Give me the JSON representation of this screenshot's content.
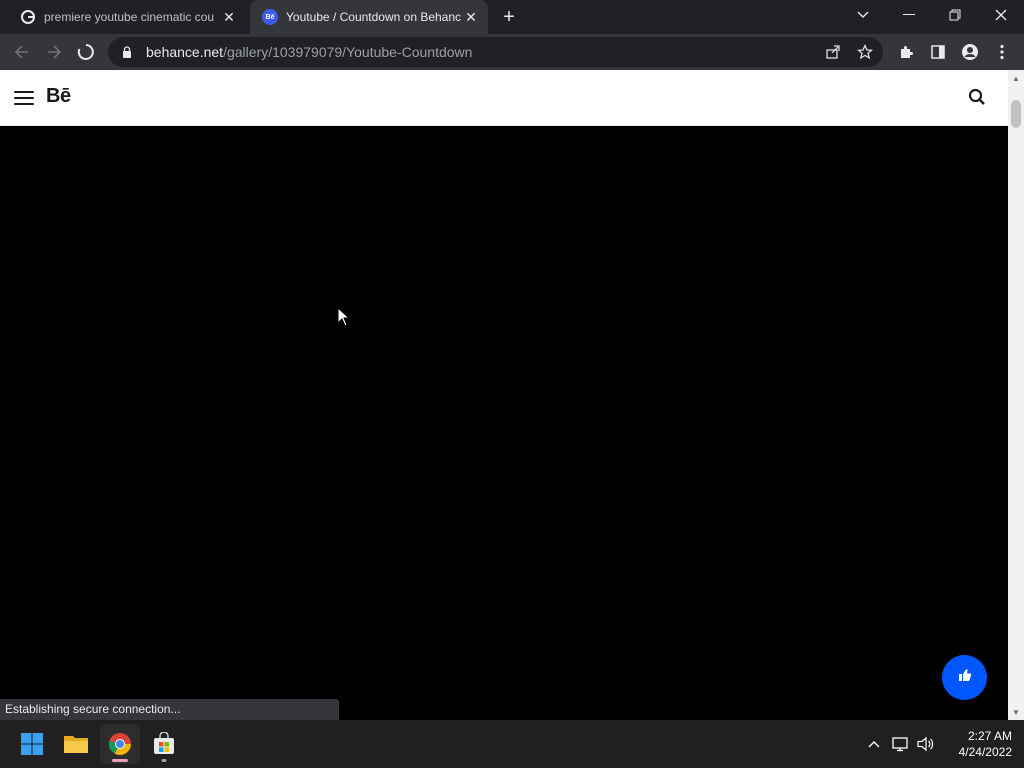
{
  "browser": {
    "tabs": [
      {
        "title": "premiere youtube cinematic cou",
        "favicon": "google-g-icon",
        "active": false
      },
      {
        "title": "Youtube / Countdown on Behanc",
        "favicon": "behance-icon",
        "active": true
      }
    ],
    "url_domain": "behance.net",
    "url_path": "/gallery/103979079/Youtube-Countdown",
    "status_text": "Establishing secure connection..."
  },
  "page": {
    "logo": "Bē",
    "like_button_icon": "thumbs-up-icon",
    "background": "#000000"
  },
  "taskbar": {
    "apps": [
      "windows-start",
      "file-explorer",
      "chrome",
      "microsoft-store"
    ],
    "time": "2:27 AM",
    "date": "4/24/2022"
  },
  "colors": {
    "behance_blue": "#0057ff",
    "chrome_dark": "#202124",
    "chrome_toolbar": "#35363a"
  }
}
